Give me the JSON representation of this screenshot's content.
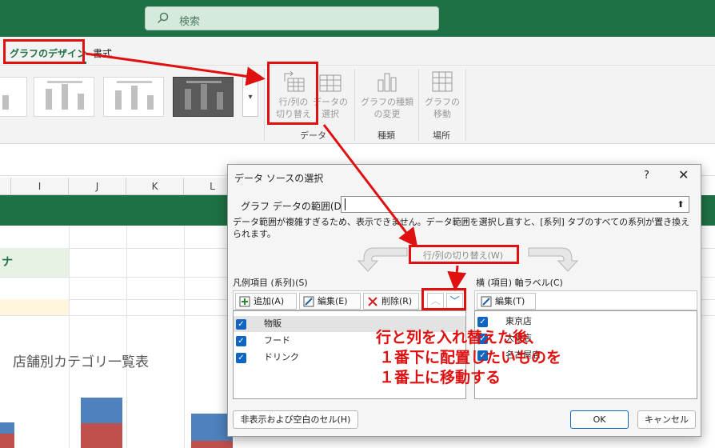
{
  "search": {
    "placeholder": "検索"
  },
  "tabs": {
    "chart_design": "グラフのデザイン",
    "format": "書式"
  },
  "ribbon": {
    "switch_row_col": [
      "行/列の",
      "切り替え"
    ],
    "select_data": [
      "データの",
      "選択"
    ],
    "change_chart_type": [
      "グラフの種類",
      "の変更"
    ],
    "move_chart": [
      "グラフの",
      "移動"
    ],
    "group_data": "データ",
    "group_type": "種類",
    "group_location": "場所"
  },
  "sheet": {
    "columns": [
      "I",
      "J",
      "K",
      "L"
    ],
    "cell_text": "ナ",
    "chart_title": "店舗別カテゴリ一覧表"
  },
  "chart_data": {
    "type": "bar",
    "title": "店舗別カテゴリ一覧表",
    "series_colors": [
      "#4f81bd",
      "#c0504d"
    ]
  },
  "dialog": {
    "title": "データ ソースの選択",
    "help": "?",
    "close": "✕",
    "range_label": "グラフ データの範囲(D):",
    "range_value": "",
    "range_message": "データ範囲が複雑すぎるため、表示できません。データ範囲を選択し直すと、[系列] タブのすべての系列が置き換えられます。",
    "switch_button": "行/列の切り替え(W)",
    "legend_header": "凡例項目 (系列)(S)",
    "axis_header": "横 (項目) 軸ラベル(C)",
    "add": "追加(A)",
    "edit": "編集(E)",
    "remove": "削除(R)",
    "axis_edit": "編集(T)",
    "series": [
      "物販",
      "フード",
      "ドリンク"
    ],
    "axis_labels": [
      "東京店",
      "大阪店",
      "名古屋店"
    ],
    "hidden_cells": "非表示および空白のセル(H)",
    "ok": "OK",
    "cancel": "キャンセル"
  },
  "annotation": [
    "行と列を入れ替えた後、",
    "１番下に配置したいものを",
    "１番上に移動する"
  ],
  "colors": {
    "excel_green": "#1e7145",
    "annotation_red": "#e01010",
    "checkbox_blue": "#0f65c0"
  }
}
